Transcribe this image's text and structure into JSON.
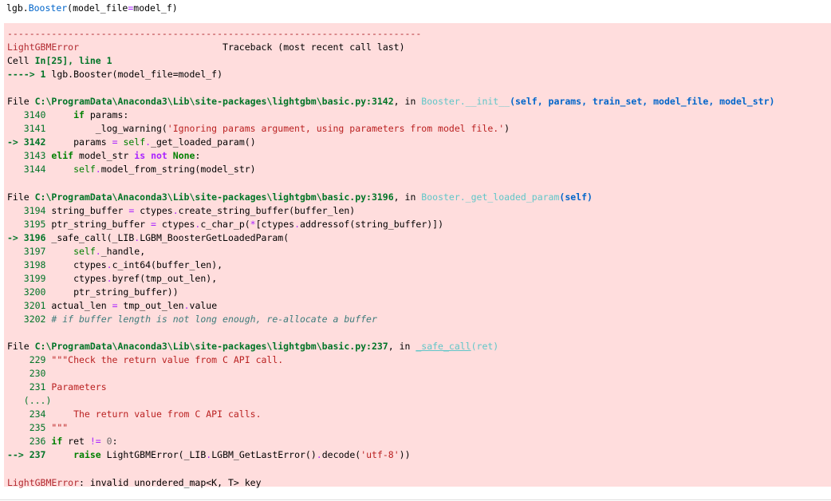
{
  "cell_input": {
    "text": "lgb.Booster(model_file=model_f)"
  },
  "traceback": {
    "dashes": "---------------------------------------------------------------------------",
    "error_name": "LightGBMError",
    "header_right": "Traceback (most recent call last)",
    "cell_ref": "Cell In[25], line 1",
    "cell_ref_prefix": "Cell ",
    "cell_ref_mid": "In[25], line 1",
    "arrow_line": "----> 1 lgb.Booster(model_file=model_f)",
    "arrow_prefix": "----> 1 ",
    "arrow_code": "lgb.Booster(model_file=model_f)",
    "frame1": {
      "file_prefix": "File ",
      "path": "C:\\ProgramData\\Anaconda3\\Lib\\site-packages\\lightgbm\\basic.py:3142",
      "in": ", in ",
      "func": "Booster.__init__",
      "args": "(self, params, train_set, model_file, model_str)",
      "lines": [
        {
          "no": "3140",
          "code": "    if params:"
        },
        {
          "no": "3141",
          "code": "        _log_warning('Ignoring params argument, using parameters from model file.')"
        },
        {
          "no": "3142",
          "code": "    params = self._get_loaded_param()"
        },
        {
          "no": "3143",
          "code": "elif model_str is not None:"
        },
        {
          "no": "3144",
          "code": "    self.model_from_string(model_str)"
        }
      ]
    },
    "frame2": {
      "file_prefix": "File ",
      "path": "C:\\ProgramData\\Anaconda3\\Lib\\site-packages\\lightgbm\\basic.py:3196",
      "in": ", in ",
      "func": "Booster._get_loaded_param",
      "args": "(self)",
      "lines": [
        {
          "no": "3194",
          "code": "string_buffer = ctypes.create_string_buffer(buffer_len)"
        },
        {
          "no": "3195",
          "code": "ptr_string_buffer = ctypes.c_char_p(*[ctypes.addressof(string_buffer)])"
        },
        {
          "no": "3196",
          "code": "_safe_call(_LIB.LGBM_BoosterGetLoadedParam("
        },
        {
          "no": "3197",
          "code": "    self._handle,"
        },
        {
          "no": "3198",
          "code": "    ctypes.c_int64(buffer_len),"
        },
        {
          "no": "3199",
          "code": "    ctypes.byref(tmp_out_len),"
        },
        {
          "no": "3200",
          "code": "    ptr_string_buffer))"
        },
        {
          "no": "3201",
          "code": "actual_len = tmp_out_len.value"
        },
        {
          "no": "3202",
          "code": "# if buffer length is not long enough, re-allocate a buffer"
        }
      ]
    },
    "frame3": {
      "file_prefix": "File ",
      "path": "C:\\ProgramData\\Anaconda3\\Lib\\site-packages\\lightgbm\\basic.py:237",
      "in": ", in ",
      "func": "_safe_call",
      "args": "(ret)",
      "lines": [
        {
          "no": "229",
          "code": "\"\"\"Check the return value from C API call."
        },
        {
          "no": "230",
          "code": ""
        },
        {
          "no": "231",
          "code": "Parameters"
        },
        {
          "no": "(...)",
          "code": ""
        },
        {
          "no": "234",
          "code": "    The return value from C API calls."
        },
        {
          "no": "235",
          "code": "\"\"\""
        },
        {
          "no": "236",
          "code": "if ret != 0:"
        },
        {
          "no": "237",
          "code": "    raise LightGBMError(_LIB.LGBM_GetLastError().decode('utf-8'))"
        }
      ]
    },
    "final_error_name": "LightGBMError",
    "final_message": ": invalid unordered_map<K, T> key"
  },
  "colors": {
    "error_bg": "#ffdddd",
    "error_red": "#b22b31",
    "lineno_green": "#007427",
    "func_cyan": "#60c6c8",
    "args_blue": "#0065ca"
  }
}
